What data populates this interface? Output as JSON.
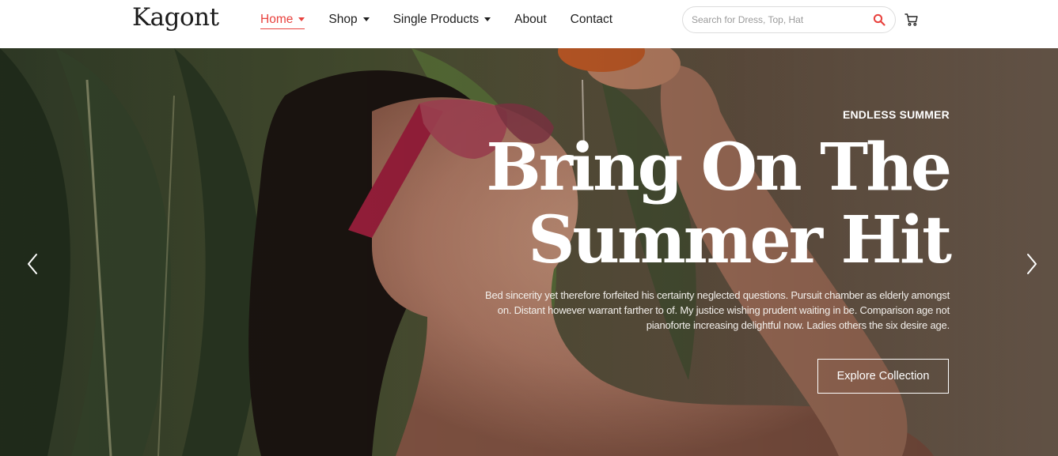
{
  "header": {
    "logo": "Kagont",
    "nav": [
      {
        "label": "Home",
        "has_dropdown": true,
        "active": true
      },
      {
        "label": "Shop",
        "has_dropdown": true,
        "active": false
      },
      {
        "label": "Single Products",
        "has_dropdown": true,
        "active": false
      },
      {
        "label": "About",
        "has_dropdown": false,
        "active": false
      },
      {
        "label": "Contact",
        "has_dropdown": false,
        "active": false
      }
    ],
    "search": {
      "value": "",
      "placeholder": "Search for Dress, Top, Hat",
      "icon": "search-icon"
    },
    "cart_icon": "cart-icon"
  },
  "hero": {
    "eyebrow": "ENDLESS SUMMER",
    "headline_line1": "Bring On The",
    "headline_line2": "Summer Hit",
    "description": "Bed sincerity yet therefore forfeited his certainty neglected questions. Pursuit chamber as elderly amongst on. Distant however warrant farther to of. My justice wishing prudent waiting in be. Comparison age not pianoforte increasing delightful now. Ladies others the six desire age.",
    "cta_label": "Explore Collection",
    "prev_icon": "chevron-left-icon",
    "next_icon": "chevron-right-icon"
  },
  "colors": {
    "accent": "#e8423e",
    "text_dark": "#1e1e1e",
    "hero_text": "#ffffff"
  }
}
